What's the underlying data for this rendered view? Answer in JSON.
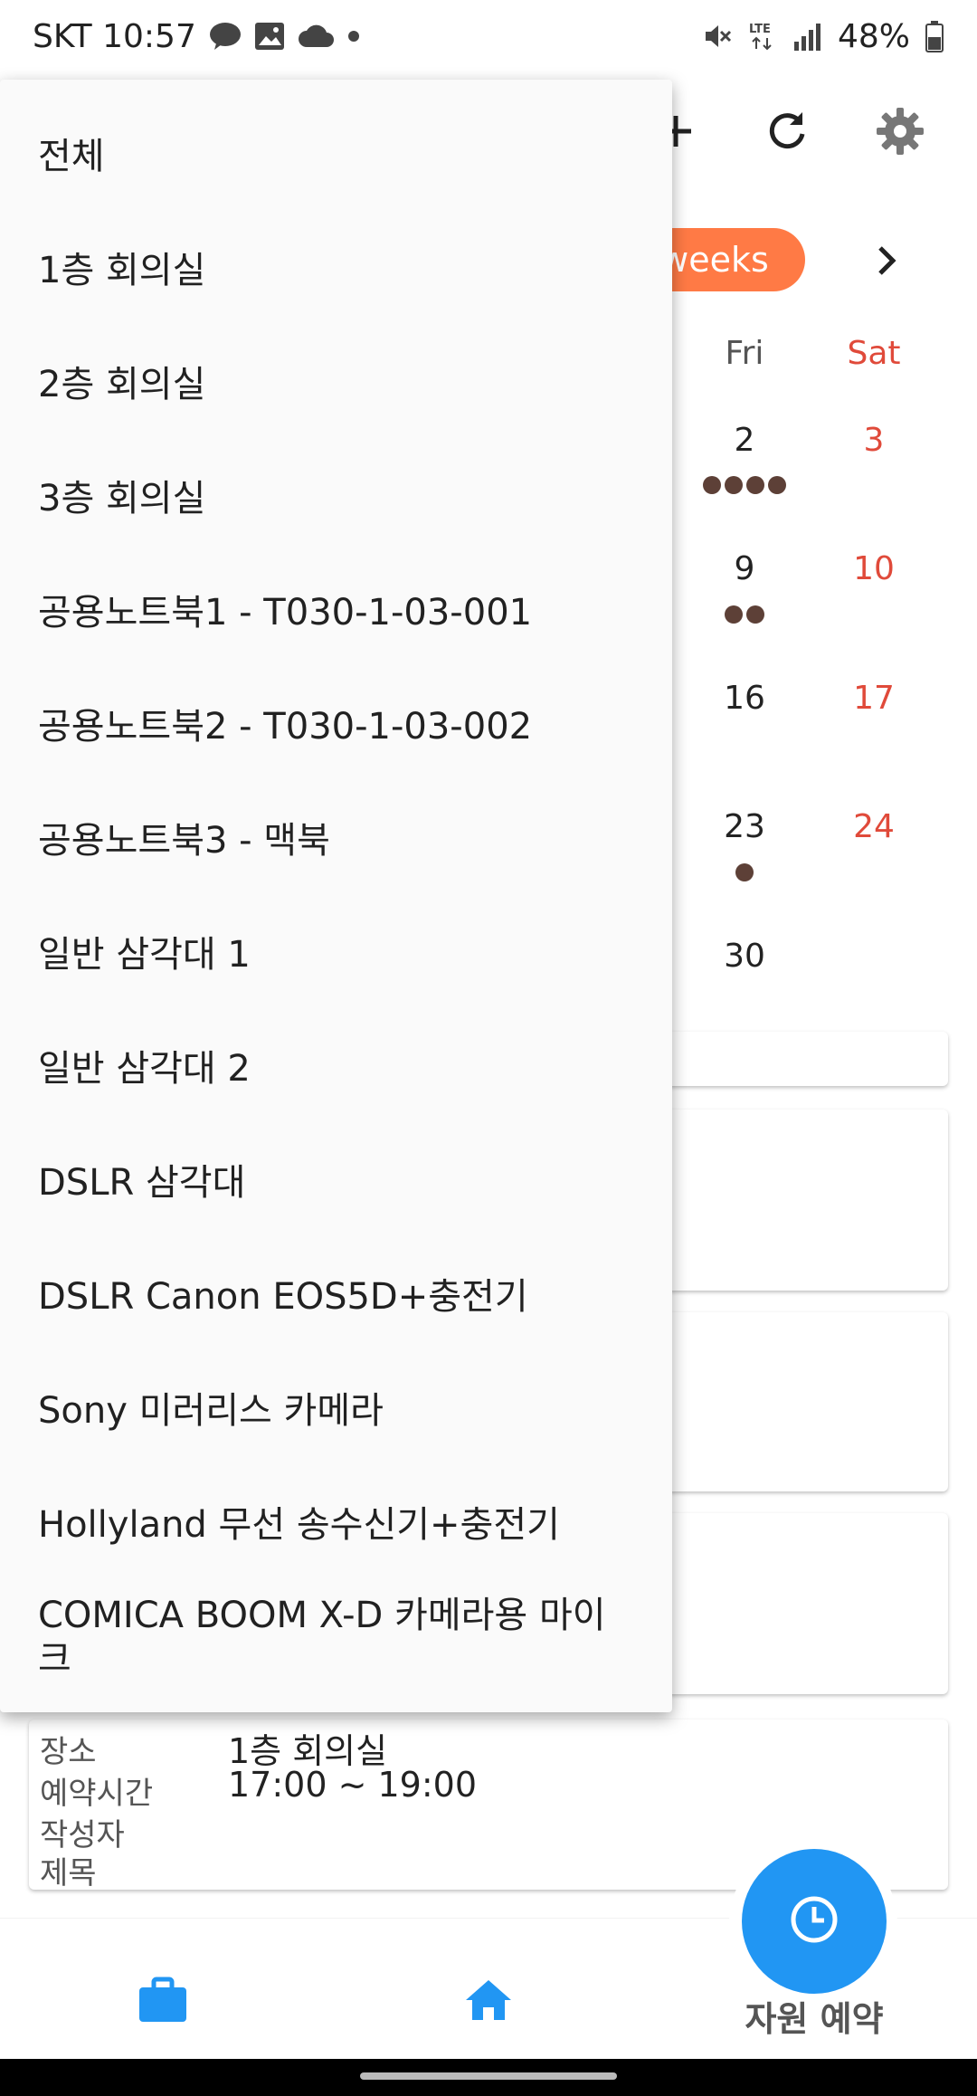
{
  "status_bar": {
    "carrier_time": "SKT 10:57",
    "battery": "48%",
    "icons": [
      "talk-icon",
      "image-icon",
      "cloud-icon",
      "dot-icon",
      "mute-icon",
      "lte-icon",
      "signal-icon",
      "battery-icon"
    ]
  },
  "calendar": {
    "toggle_label": "weeks",
    "days_of_week": {
      "fri": "Fri",
      "sat": "Sat"
    },
    "rows": [
      {
        "fri": "2",
        "sat": "3",
        "fri_dots": 4
      },
      {
        "fri": "9",
        "sat": "10",
        "fri_dots": 2
      },
      {
        "fri": "16",
        "sat": "17",
        "fri_dots": 0
      },
      {
        "fri": "23",
        "sat": "24",
        "fri_dots": 1
      },
      {
        "fri": "30",
        "sat": "",
        "fri_dots": 0
      }
    ]
  },
  "detail_card": {
    "place_label": "장소",
    "place_value": "1층 회의실",
    "time_label": "예약시간",
    "time_value": "17:00 ~ 19:00",
    "author_label": "작성자",
    "title_label": "제목"
  },
  "menu": {
    "items": [
      "전체",
      "1층 회의실",
      "2층 회의실",
      "3층 회의실",
      "공용노트북1  - T030-1-03-001",
      "공용노트북2 - T030-1-03-002",
      "공용노트북3 - 맥북",
      "일반 삼각대 1",
      "일반 삼각대 2",
      "DSLR 삼각대",
      "DSLR Canon EOS5D+충전기",
      "Sony 미러리스 카메라",
      "Hollyland 무선 송수신기+충전기",
      "COMICA BOOM X-D 카메라용 마이크"
    ]
  },
  "bottom_nav": {
    "fab_label": "자원 예약"
  },
  "colors": {
    "accent": "#2196f3",
    "pill": "#ff7a45",
    "weekend": "#e04a3a",
    "dot": "#5d4037"
  }
}
